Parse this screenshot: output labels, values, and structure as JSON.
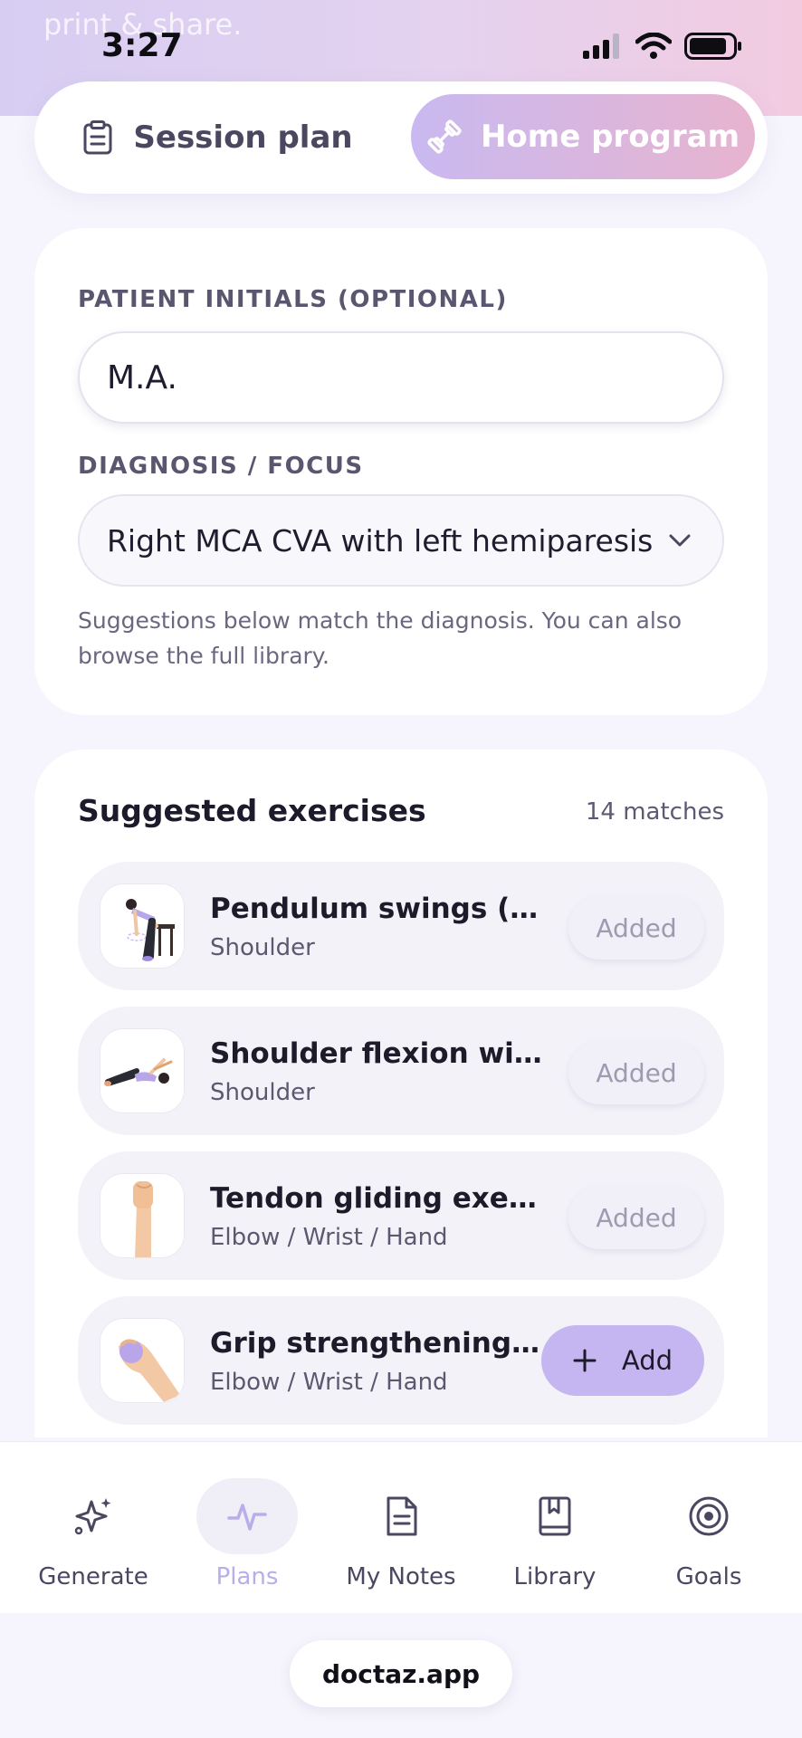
{
  "status_bar": {
    "time": "3:27",
    "ghost_text": "print & share."
  },
  "mode_toggle": {
    "options": [
      "Session plan",
      "Home program"
    ],
    "selected": "Home program"
  },
  "patient": {
    "initials_label": "PATIENT INITIALS (OPTIONAL)",
    "initials_value": "M.A.",
    "diagnosis_label": "DIAGNOSIS / FOCUS",
    "diagnosis_value": "Right MCA CVA with left hemiparesis",
    "hint": "Suggestions below match the diagnosis. You can also browse the full library."
  },
  "suggestions": {
    "title": "Suggested exercises",
    "count": "14 matches",
    "items": [
      {
        "name": "Pendulum swings (Codman's)",
        "category": "Shoulder",
        "action": "Added"
      },
      {
        "name": "Shoulder flexion with cane",
        "category": "Shoulder",
        "action": "Added"
      },
      {
        "name": "Tendon gliding exercises",
        "category": "Elbow / Wrist / Hand",
        "action": "Added"
      },
      {
        "name": "Grip strengthening (putty)",
        "category": "Elbow / Wrist / Hand",
        "action": "Add"
      }
    ]
  },
  "bottom_nav": {
    "items": [
      {
        "label": "Generate",
        "icon": "sparkle-icon"
      },
      {
        "label": "Plans",
        "icon": "pulse-icon"
      },
      {
        "label": "My Notes",
        "icon": "document-icon"
      },
      {
        "label": "Library",
        "icon": "book-icon"
      },
      {
        "label": "Goals",
        "icon": "target-icon"
      }
    ],
    "active": "Plans"
  },
  "browser": {
    "url": "doctaz.app"
  },
  "colors": {
    "accent": "#c5b6f1",
    "active_nav": "#b9adea"
  }
}
